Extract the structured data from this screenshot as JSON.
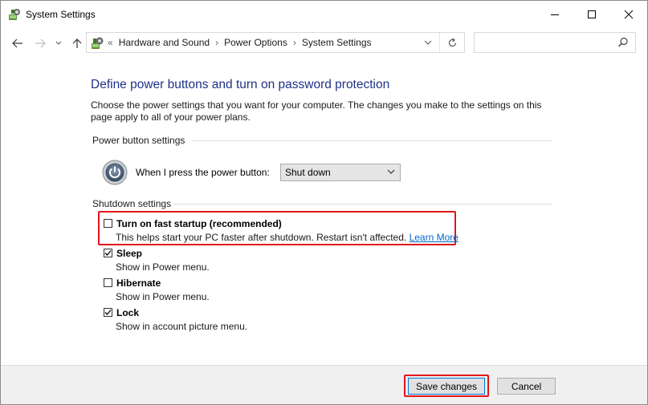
{
  "window": {
    "title": "System Settings",
    "minimize_icon": "minimize-icon",
    "maximize_icon": "maximize-icon",
    "close_icon": "close-icon"
  },
  "navigation": {
    "breadcrumbs": [
      "Hardware and Sound",
      "Power Options",
      "System Settings"
    ],
    "search": {
      "value": "",
      "placeholder": ""
    }
  },
  "main": {
    "heading": "Define power buttons and turn on password protection",
    "description": "Choose the power settings that you want for your computer. The changes you make to the settings on this page apply to all of your power plans.",
    "power_button_settings": {
      "group_title": "Power button settings",
      "label": "When I press the power button:",
      "selected": "Shut down"
    },
    "shutdown_settings": {
      "group_title": "Shutdown settings",
      "options": [
        {
          "label": "Turn on fast startup (recommended)",
          "description": "This helps start your PC faster after shutdown. Restart isn't affected.",
          "link": "Learn More",
          "checked": false
        },
        {
          "label": "Sleep",
          "description": "Show in Power menu.",
          "checked": true
        },
        {
          "label": "Hibernate",
          "description": "Show in Power menu.",
          "checked": false
        },
        {
          "label": "Lock",
          "description": "Show in account picture menu.",
          "checked": true
        }
      ]
    }
  },
  "footer": {
    "save_label": "Save changes",
    "cancel_label": "Cancel"
  },
  "colors": {
    "heading": "#1e3287",
    "link": "#0066cc",
    "highlight": "#e3151a",
    "footer_bg": "#f0f0f0"
  }
}
